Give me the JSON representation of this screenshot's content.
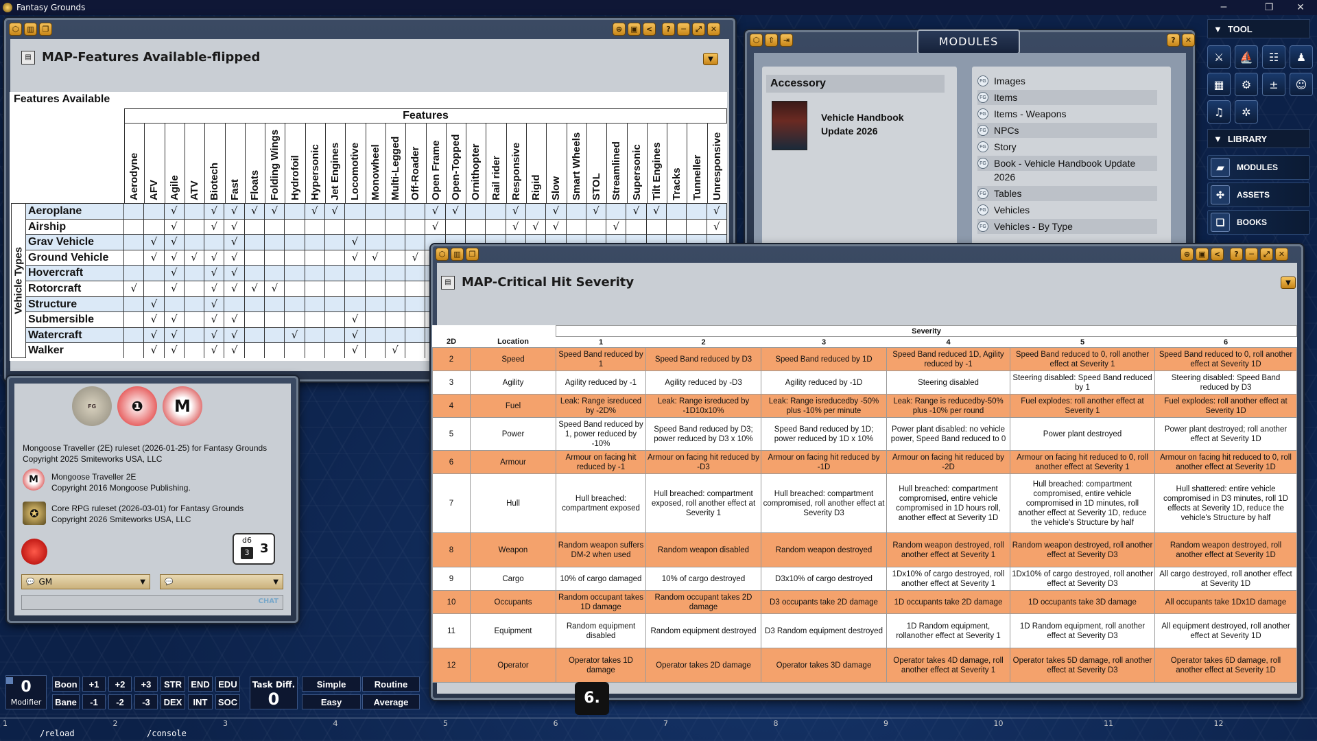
{
  "app": {
    "title": "Fantasy Grounds"
  },
  "features_window": {
    "title": "MAP-Features Available-flipped",
    "heading": "Features Available",
    "group_label": "Features",
    "row_group_label": "Vehicle Types",
    "columns": [
      "Aerodyne",
      "AFV",
      "Agile",
      "ATV",
      "Biotech",
      "Fast",
      "Floats",
      "Folding Wings",
      "Hydrofoil",
      "Hypersonic",
      "Jet Engines",
      "Locomotive",
      "Monowheel",
      "Multi-Legged",
      "Off-Roader",
      "Open Frame",
      "Open-Topped",
      "Ornithopter",
      "Rail rider",
      "Responsive",
      "Rigid",
      "Slow",
      "Smart Wheels",
      "STOL",
      "Streamlined",
      "Supersonic",
      "Tilt Engines",
      "Tracks",
      "Tunneller",
      "Unresponsive"
    ],
    "rows": [
      {
        "label": "Aeroplane",
        "cells": [
          "",
          "",
          "√",
          "",
          "√",
          "√",
          "√",
          "√",
          "",
          "√",
          "√",
          "",
          "",
          "",
          "",
          "√",
          "√",
          "",
          "",
          "√",
          "",
          "√",
          "",
          "√",
          "",
          "√",
          "√",
          "",
          "",
          "√"
        ]
      },
      {
        "label": "Airship",
        "cells": [
          "",
          "",
          "√",
          "",
          "√",
          "√",
          "",
          "",
          "",
          "",
          "",
          "",
          "",
          "",
          "",
          "√",
          "",
          "",
          "",
          "√",
          "√",
          "√",
          "",
          "",
          "√",
          "",
          "",
          "",
          "",
          "√"
        ]
      },
      {
        "label": "Grav Vehicle",
        "cells": [
          "",
          "√",
          "√",
          "",
          "",
          "√",
          "",
          "",
          "",
          "",
          "",
          "√",
          "",
          "",
          "",
          "",
          "",
          "",
          "",
          "",
          "",
          "",
          "",
          "",
          "",
          "",
          "",
          "",
          "",
          ""
        ]
      },
      {
        "label": "Ground Vehicle",
        "cells": [
          "",
          "√",
          "√",
          "√",
          "√",
          "√",
          "",
          "",
          "",
          "",
          "",
          "√",
          "√",
          "",
          "√",
          "",
          "",
          "",
          "",
          "",
          "",
          "",
          "",
          "",
          "",
          "",
          "",
          "",
          "",
          ""
        ]
      },
      {
        "label": "Hovercraft",
        "cells": [
          "",
          "",
          "√",
          "",
          "√",
          "√",
          "",
          "",
          "",
          "",
          "",
          "",
          "",
          "",
          "",
          "",
          "",
          "",
          "",
          "",
          "",
          "",
          "",
          "",
          "",
          "",
          "",
          "",
          "",
          ""
        ]
      },
      {
        "label": "Rotorcraft",
        "cells": [
          "√",
          "",
          "√",
          "",
          "√",
          "√",
          "√",
          "√",
          "",
          "",
          "",
          "",
          "",
          "",
          "",
          "",
          "",
          "",
          "",
          "",
          "",
          "",
          "",
          "",
          "",
          "",
          "",
          "",
          "",
          ""
        ]
      },
      {
        "label": "Structure",
        "cells": [
          "",
          "√",
          "",
          "",
          "√",
          "",
          "",
          "",
          "",
          "",
          "",
          "",
          "",
          "",
          "",
          "",
          "",
          "",
          "",
          "",
          "",
          "",
          "",
          "",
          "",
          "",
          "",
          "",
          "",
          ""
        ]
      },
      {
        "label": "Submersible",
        "cells": [
          "",
          "√",
          "√",
          "",
          "√",
          "√",
          "",
          "",
          "",
          "",
          "",
          "√",
          "",
          "",
          "",
          "",
          "",
          "",
          "",
          "",
          "",
          "",
          "",
          "",
          "",
          "",
          "",
          "",
          "",
          ""
        ]
      },
      {
        "label": "Watercraft",
        "cells": [
          "",
          "√",
          "√",
          "",
          "√",
          "√",
          "",
          "",
          "√",
          "",
          "",
          "√",
          "",
          "",
          "",
          "",
          "",
          "",
          "",
          "",
          "",
          "",
          "",
          "",
          "",
          "",
          "",
          "",
          "",
          ""
        ]
      },
      {
        "label": "Walker",
        "cells": [
          "",
          "√",
          "√",
          "",
          "√",
          "√",
          "",
          "",
          "",
          "",
          "",
          "√",
          "",
          "√",
          "",
          "",
          "",
          "",
          "",
          "",
          "",
          "",
          "",
          "",
          "",
          "",
          "",
          "",
          "",
          ""
        ]
      }
    ]
  },
  "about": {
    "logos": [
      "FANTASY GROUNDS",
      "Traveller",
      "Mongoose"
    ],
    "lines": [
      "Mongoose Traveller (2E) ruleset (2026-01-25) for Fantasy Grounds",
      "Copyright 2025 Smiteworks USA, LLC"
    ],
    "entries": [
      {
        "line1": "Mongoose Traveller 2E",
        "line2": "Copyright 2016 Mongoose Publishing."
      },
      {
        "line1": "Core RPG ruleset (2026-03-01) for Fantasy Grounds",
        "line2": "Copyright 2026 Smiteworks USA, LLC"
      }
    ],
    "dice": {
      "label": "d6",
      "value": "3",
      "result": "3"
    },
    "chat_identity": "GM",
    "chat_mode": "",
    "chat_button": "CHAT"
  },
  "modules": {
    "title": "MODULES",
    "accessory_label": "Accessory",
    "module_name_1": "Vehicle Handbook",
    "module_name_2": "Update 2026",
    "items": [
      "Images",
      "Items",
      "Items - Weapons",
      "NPCs",
      "Story",
      "Book - Vehicle Handbook Update",
      "2026",
      "Tables",
      "Vehicles",
      "Vehicles - By Type"
    ]
  },
  "sidebar": {
    "tool_label": "TOOL",
    "library_label": "LIBRARY",
    "library_items": [
      "MODULES",
      "ASSETS",
      "BOOKS"
    ]
  },
  "crit_window": {
    "title": "MAP-Critical Hit Severity",
    "severity_label": "Severity",
    "headers": [
      "2D",
      "Location",
      "1",
      "2",
      "3",
      "4",
      "5",
      "6"
    ],
    "rows": [
      {
        "roll": "2",
        "location": "Speed",
        "cells": [
          "Speed Band reduced by 1",
          "Speed Band reduced by D3",
          "Speed Band reduced by 1D",
          "Speed Band reduced 1D, Agility reduced by -1",
          "Speed Band reduced to 0, roll another effect at Severity 1",
          "Speed Band reduced to 0, roll another effect at Severity 1D"
        ]
      },
      {
        "roll": "3",
        "location": "Agility",
        "cells": [
          "Agility reduced by -1",
          "Agility reduced by -D3",
          "Agility reduced by -1D",
          "Steering disabled",
          "Steering disabled: Speed Band reduced by 1",
          "Steering disabled: Speed Band reduced by D3"
        ]
      },
      {
        "roll": "4",
        "location": "Fuel",
        "cells": [
          "Leak: Range isreduced by -2D%",
          "Leak: Range isreduced by -1D10x10%",
          "Leak: Range isreducedby -50% plus -10% per minute",
          "Leak: Range is reducedby-50% plus -10% per round",
          "Fuel explodes: roll another effect at Severity 1",
          "Fuel explodes: roll another effect at Severity 1D"
        ]
      },
      {
        "roll": "5",
        "location": "Power",
        "cells": [
          "Speed Band reduced by 1, power reduced by -10%",
          "Speed Band reduced by D3; power reduced by D3 x 10%",
          "Speed Band reduced by 1D; power reduced by 1D x 10%",
          "Power plant disabled: no vehicle power, Speed Band reduced to 0",
          "Power plant destroyed",
          "Power plant destroyed; roll another effect at Severity 1D"
        ]
      },
      {
        "roll": "6",
        "location": "Armour",
        "cells": [
          "Armour on facing hit reduced by -1",
          "Armour on facing hit reduced by -D3",
          "Armour on facing hit reduced by -1D",
          "Armour on facing hit reduced by -2D",
          "Armour on facing hit reduced to 0, roll another effect at Severity 1",
          "Armour on facing hit reduced to 0, roll another effect at Severity 1D"
        ]
      },
      {
        "roll": "7",
        "location": "Hull",
        "cells": [
          "Hull breached: compartment exposed",
          "Hull breached: compartment exposed, roll another effect at Severity 1",
          "Hull breached: compartment compromised, roll another effect at Severity D3",
          "Hull breached: compartment compromised, entire vehicle compromised in 1D hours roll, another effect at Severity 1D",
          "Hull breached: compartment compromised, entire vehicle compromised in 1D minutes, roll another effect at Severity 1D, reduce the vehicle's Structure by half",
          "Hull shattered: entire vehicle compromised in D3 minutes, roll 1D effects at Severity 1D, reduce the vehicle's Structure by half"
        ]
      },
      {
        "roll": "8",
        "location": "Weapon",
        "cells": [
          "Random weapon suffers DM-2 when used",
          "Random weapon disabled",
          "Random weapon destroyed",
          "Random weapon destroyed, roll another effect at Severity 1",
          "Random weapon destroyed, roll another effect at Severity D3",
          "Random weapon destroyed, roll another effect at Severity 1D"
        ]
      },
      {
        "roll": "9",
        "location": "Cargo",
        "cells": [
          "10% of cargo damaged",
          "10% of cargo destroyed",
          "D3x10% of cargo destroyed",
          "1Dx10% of cargo destroyed, roll another effect at Severity 1",
          "1Dx10% of cargo destroyed, roll another effect at Severity D3",
          "All cargo destroyed, roll another effect at Severity 1D"
        ]
      },
      {
        "roll": "10",
        "location": "Occupants",
        "cells": [
          "Random occupant takes 1D damage",
          "Random occupant takes 2D damage",
          "D3 occupants take 2D damage",
          "1D occupants take 2D damage",
          "1D occupants take 3D damage",
          "All occupants take 1Dx1D damage"
        ]
      },
      {
        "roll": "11",
        "location": "Equipment",
        "cells": [
          "Random equipment disabled",
          "Random equipment destroyed",
          "D3 Random equipment destroyed",
          "1D Random equipment, rollanother effect at Severity 1",
          "1D Random equipment, roll another effect at Severity D3",
          "All equipment destroyed, roll another effect at Severity 1D"
        ]
      },
      {
        "roll": "12",
        "location": "Operator",
        "cells": [
          "Operator takes 1D damage",
          "Operator takes 2D damage",
          "Operator takes 3D damage",
          "Operator takes 4D damage, roll another effect at Severity 1",
          "Operator takes 5D damage, roll another effect at Severity D3",
          "Operator takes 6D damage, roll another effect at Severity 1D"
        ]
      }
    ]
  },
  "modifier": {
    "value": "0",
    "label": "Modifier"
  },
  "dice_buttons": {
    "row1": [
      "Boon",
      "+1",
      "+2",
      "+3",
      "STR",
      "END",
      "EDU"
    ],
    "row2": [
      "Bane",
      "-1",
      "-2",
      "-3",
      "DEX",
      "INT",
      "SOC"
    ]
  },
  "task": {
    "label": "Task Diff.",
    "value": "0",
    "options": [
      "Simple",
      "Routine",
      "Easy",
      "Average"
    ]
  },
  "page_badge": "6.",
  "hotkeys": [
    "1",
    "2",
    "3",
    "4",
    "5",
    "6",
    "7",
    "8",
    "9",
    "10",
    "11",
    "12"
  ],
  "macros": [
    "/reload",
    "/console"
  ],
  "colors": {
    "orange_row": "#f4a26c",
    "accent_gold": "#e2a63a",
    "bg_blue": "#0c2148"
  }
}
